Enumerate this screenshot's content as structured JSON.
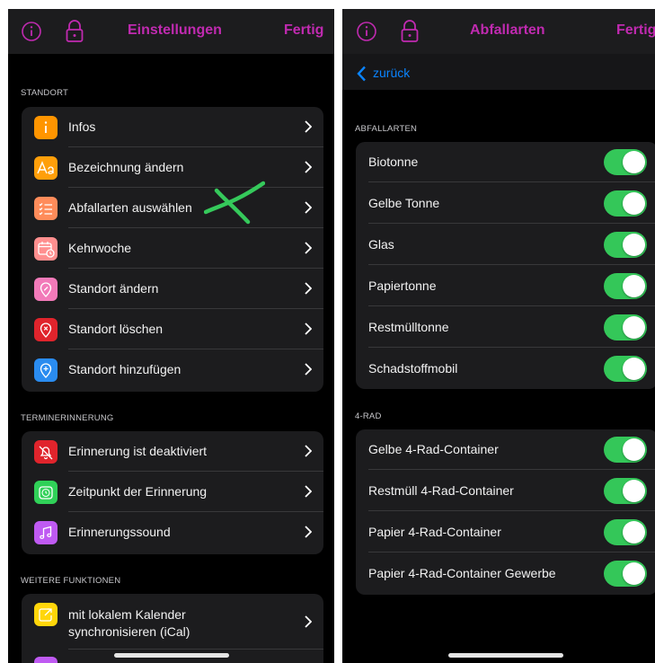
{
  "left": {
    "nav": {
      "title": "Einstellungen",
      "done": "Fertig"
    },
    "sections": [
      {
        "header": "STANDORT",
        "items": [
          {
            "label": "Infos",
            "icon": "info-icon",
            "color": "#ff9500"
          },
          {
            "label": "Bezeichnung ändern",
            "icon": "text-format-icon",
            "color": "#ff9f0a"
          },
          {
            "label": "Abfallarten auswählen",
            "icon": "list-icon",
            "color": "#ff8c5a"
          },
          {
            "label": "Kehrwoche",
            "icon": "calendar-clock-icon",
            "color": "#ff8f8f"
          },
          {
            "label": "Standort ändern",
            "icon": "location-edit-icon",
            "color": "#f27ab9"
          },
          {
            "label": "Standort löschen",
            "icon": "location-delete-icon",
            "color": "#e0242c"
          },
          {
            "label": "Standort hinzufügen",
            "icon": "location-add-icon",
            "color": "#2a8cf0"
          }
        ]
      },
      {
        "header": "TERMINERINNERUNG",
        "items": [
          {
            "label": "Erinnerung ist deaktiviert",
            "icon": "bell-slash-icon",
            "color": "#e0242c"
          },
          {
            "label": "Zeitpunkt der Erinnerung",
            "icon": "alarm-clock-icon",
            "color": "#30d158"
          },
          {
            "label": "Erinnerungssound",
            "icon": "music-note-icon",
            "color": "#bf5af2"
          }
        ]
      },
      {
        "header": "WEITERE FUNKTIONEN",
        "items": [
          {
            "label": "mit lokalem Kalender\nsynchronisieren (iCal)",
            "icon": "calendar-export-icon",
            "color": "#ffd60a"
          }
        ]
      }
    ]
  },
  "right": {
    "nav": {
      "title": "Abfallarten",
      "done": "Fertig",
      "back": "zurück"
    },
    "sections": [
      {
        "header": "ABFALLARTEN",
        "items": [
          {
            "label": "Biotonne",
            "enabled": true
          },
          {
            "label": "Gelbe Tonne",
            "enabled": true
          },
          {
            "label": "Glas",
            "enabled": true
          },
          {
            "label": "Papiertonne",
            "enabled": true
          },
          {
            "label": "Restmülltonne",
            "enabled": true
          },
          {
            "label": "Schadstoffmobil",
            "enabled": true
          }
        ]
      },
      {
        "header": "4-RAD",
        "items": [
          {
            "label": "Gelbe 4-Rad-Container",
            "enabled": true
          },
          {
            "label": "Restmüll 4-Rad-Container",
            "enabled": true
          },
          {
            "label": "Papier 4-Rad-Container",
            "enabled": true
          },
          {
            "label": "Papier 4-Rad-Container Gewerbe",
            "enabled": true
          }
        ]
      }
    ]
  },
  "colors": {
    "accent": "#c02ab0",
    "link": "#0a84ff",
    "switch_on": "#34c759",
    "annotation": "#35c95b"
  }
}
